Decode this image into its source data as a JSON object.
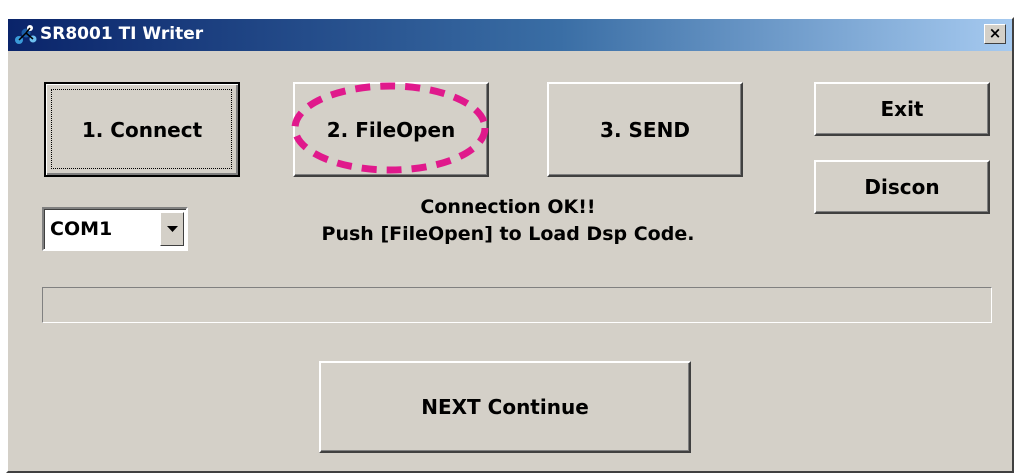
{
  "window": {
    "title": "SR8001 TI Writer",
    "close_label": "×"
  },
  "buttons": {
    "connect": "1. Connect",
    "fileopen": "2. FileOpen",
    "send": "3. SEND",
    "exit": "Exit",
    "discon": "Discon",
    "next": "NEXT Continue"
  },
  "port_select": {
    "selected": "COM1"
  },
  "status": {
    "line1": "Connection OK!!",
    "line2": "Push [FileOpen] to Load Dsp Code."
  },
  "progress": {
    "value": 0
  },
  "icons": {
    "app": "molecule-app-icon",
    "close": "close-icon",
    "dropdown": "chevron-down-icon"
  },
  "colors": {
    "titlebar_start": "#0a246a",
    "titlebar_end": "#a6caf0",
    "face": "#d4d0c8",
    "highlight_ring": "#e0198c"
  }
}
